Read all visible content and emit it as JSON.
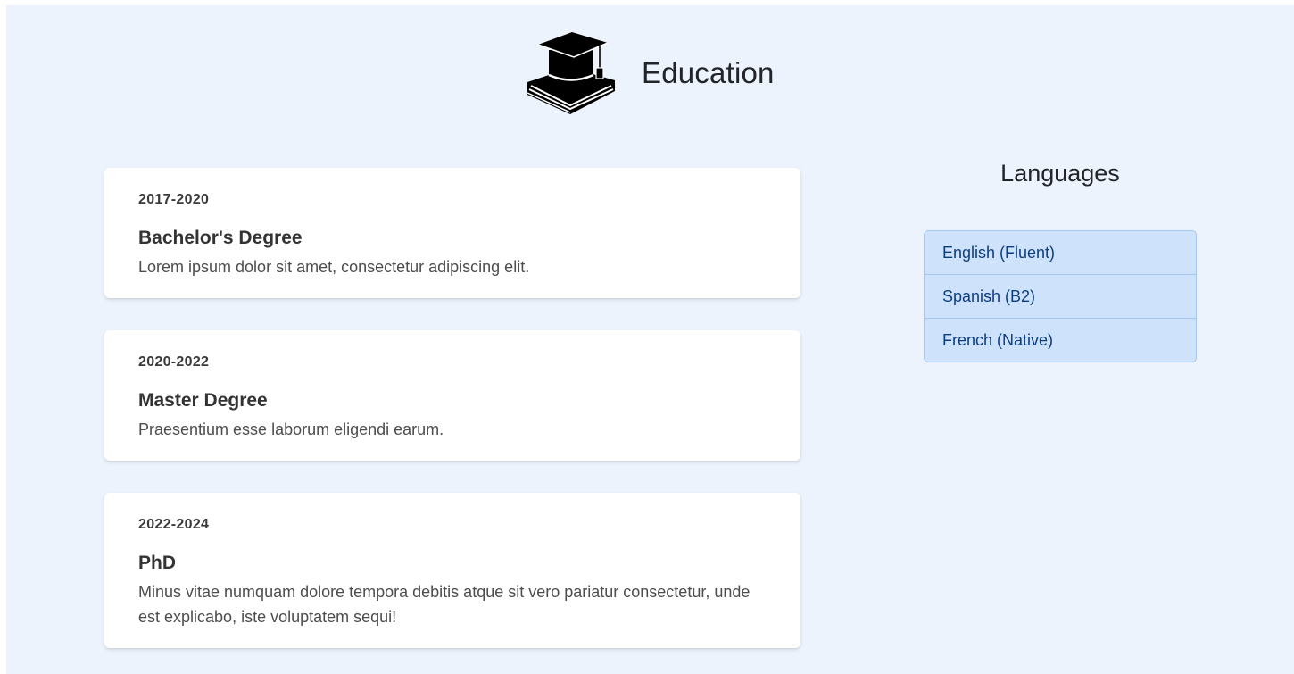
{
  "header": {
    "logo_icon": "graduation-cap-book-icon",
    "title": "Education"
  },
  "education": [
    {
      "years": "2017-2020",
      "title": "Bachelor's Degree",
      "description": "Lorem ipsum dolor sit amet, consectetur adipiscing elit."
    },
    {
      "years": "2020-2022",
      "title": "Master Degree",
      "description": "Praesentium esse laborum eligendi earum."
    },
    {
      "years": "2022-2024",
      "title": "PhD",
      "description": "Minus vitae numquam dolore tempora debitis atque sit vero pariatur consectetur, unde est explicabo, iste voluptatem sequi!"
    }
  ],
  "languages": {
    "title": "Languages",
    "items": [
      {
        "label": "English (Fluent)"
      },
      {
        "label": "Spanish (B2)"
      },
      {
        "label": "French (Native)"
      }
    ]
  },
  "colors": {
    "page_background": "#edf3fc",
    "card_background": "#ffffff",
    "language_item_background": "#cfe2fb",
    "language_item_text": "#0c3e82"
  }
}
